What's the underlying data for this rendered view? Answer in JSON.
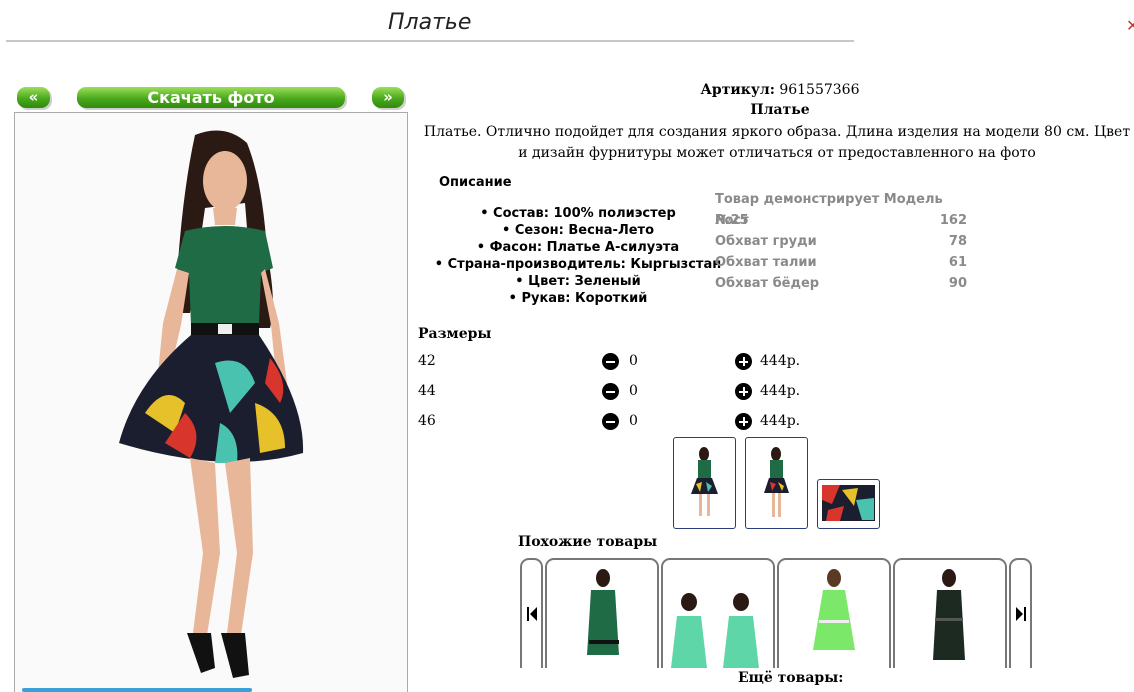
{
  "page_title": "Платье",
  "gallery": {
    "prev_label": "«",
    "download_label": "Скачать фото",
    "next_label": "»"
  },
  "product": {
    "article_label": "Артикул:",
    "article_value": "961557366",
    "name": "Платье",
    "description": "Платье. Отлично подойдет для создания яркого образа. Длина изделия на модели 80 см. Цвет и дизайн фурнитуры может отличаться от предоставленного на фото"
  },
  "options": {
    "heading": "Описание",
    "features": [
      "Состав: 100% полиэстер",
      "Сезон: Весна-Лето",
      "Фасон: Платье А-силуэта",
      "Страна-производитель: Кыргызстан",
      "Цвет: Зеленый",
      "Рукав: Короткий"
    ]
  },
  "model": {
    "heading": "Товар демонстрирует Модель №25",
    "rows": [
      {
        "label": "Рост",
        "value": "162"
      },
      {
        "label": "Обхват груди",
        "value": "78"
      },
      {
        "label": "Обхват талии",
        "value": "61"
      },
      {
        "label": "Обхват бёдер",
        "value": "90"
      }
    ]
  },
  "sizes": {
    "heading": "Размеры",
    "rows": [
      {
        "size": "42",
        "qty": "0",
        "price": "444р."
      },
      {
        "size": "44",
        "qty": "0",
        "price": "444р."
      },
      {
        "size": "46",
        "qty": "0",
        "price": "444р."
      }
    ]
  },
  "similar": {
    "heading": "Похожие товары",
    "more_label": "Ещё товары:"
  },
  "colors": {
    "green_button": "#4aa81c",
    "dress_green": "#1f6b45",
    "thumb_border": "#2a3d7a"
  }
}
